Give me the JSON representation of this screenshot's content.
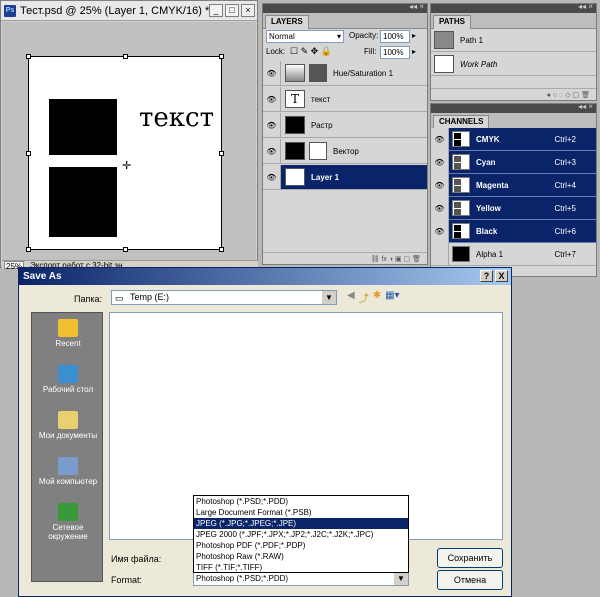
{
  "document_window": {
    "title": "Тест.psd @ 25% (Layer 1, CMYK/16) *",
    "canvas_text": "текст",
    "zoom": "25%",
    "status": "Экспорт работ с 32-bit зн"
  },
  "layers_panel": {
    "tab": "LAYERS",
    "blend_mode": "Normal",
    "opacity_label": "Opacity:",
    "opacity_value": "100%",
    "lock_label": "Lock:",
    "fill_label": "Fill:",
    "fill_value": "100%",
    "layers": [
      {
        "name": "Hue/Saturation 1"
      },
      {
        "name": "текст"
      },
      {
        "name": "Растр"
      },
      {
        "name": "Вектор"
      },
      {
        "name": "Layer 1"
      }
    ]
  },
  "paths_panel": {
    "tab": "PATHS",
    "paths": [
      {
        "name": "Path 1"
      },
      {
        "name": "Work Path"
      }
    ]
  },
  "channels_panel": {
    "tab": "CHANNELS",
    "channels": [
      {
        "name": "CMYK",
        "key": "Ctrl+2"
      },
      {
        "name": "Cyan",
        "key": "Ctrl+3"
      },
      {
        "name": "Magenta",
        "key": "Ctrl+4"
      },
      {
        "name": "Yellow",
        "key": "Ctrl+5"
      },
      {
        "name": "Black",
        "key": "Ctrl+6"
      },
      {
        "name": "Alpha 1",
        "key": "Ctrl+7"
      }
    ]
  },
  "save_dialog": {
    "title": "Save As",
    "help_btn": "?",
    "close_btn": "X",
    "folder_label": "Папка:",
    "folder_value": "Temp (E:)",
    "places": [
      {
        "label": "Recent"
      },
      {
        "label": "Рабочий стол"
      },
      {
        "label": "Мои документы"
      },
      {
        "label": "Мой компьютер"
      },
      {
        "label": "Сетевое окружение"
      }
    ],
    "filename_label": "Имя файла:",
    "format_label": "Format:",
    "format_value": "Photoshop (*.PSD;*.PDD)",
    "save_button": "Сохранить",
    "cancel_button": "Отмена",
    "format_options": [
      "Photoshop (*.PSD;*.PDD)",
      "Large Document Format (*.PSB)",
      "JPEG (*.JPG;*.JPEG;*.JPE)",
      "JPEG 2000 (*.JPF;*.JPX;*.JP2;*.J2C;*.J2K;*.JPC)",
      "Photoshop PDF (*.PDF;*.PDP)",
      "Photoshop Raw (*.RAW)",
      "TIFF (*.TIF;*.TIFF)"
    ]
  }
}
